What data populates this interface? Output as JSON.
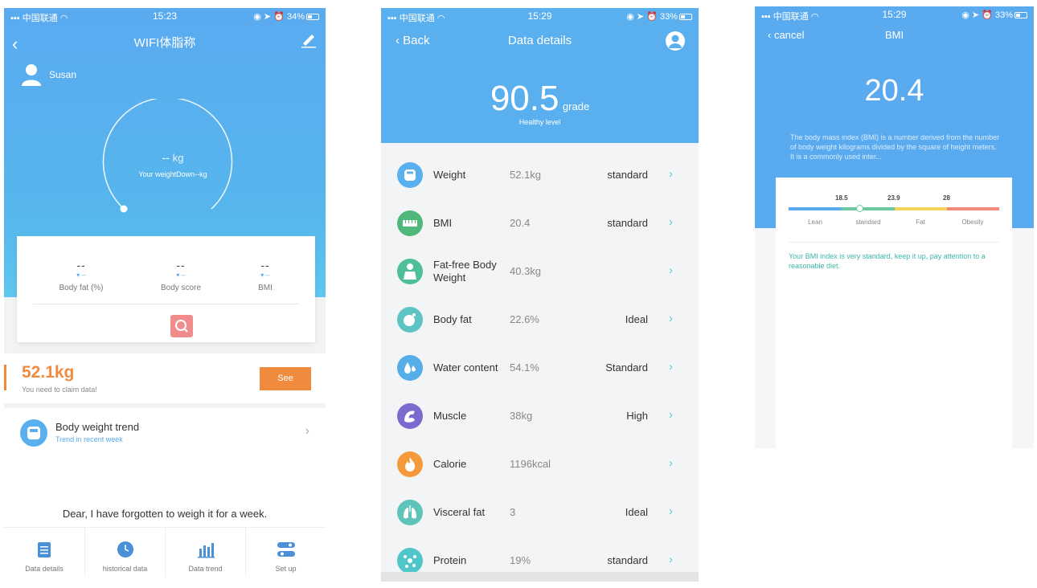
{
  "screen1": {
    "status": {
      "carrier": "中国联通",
      "time": "15:23",
      "battery": "34%"
    },
    "title": "WIFI体脂称",
    "user_name": "Susan",
    "gauge": {
      "value": "--",
      "unit": "kg",
      "subtitle": "Your weightDown--kg"
    },
    "metrics": [
      {
        "value": "--",
        "trend": "▾ --",
        "label": "Body fat (%)"
      },
      {
        "value": "--",
        "trend": "▾ --",
        "label": "Body score"
      },
      {
        "value": "--",
        "trend": "▾ --",
        "label": "BMI"
      }
    ],
    "weight": {
      "value": "52.1kg",
      "note": "You need to claim data!",
      "button": "See"
    },
    "trend": {
      "title": "Body weight trend",
      "subtitle": "Trend in recent week"
    },
    "reminder": "Dear, I have forgotten to weigh it for a week.",
    "tabs": [
      {
        "label": "Data details",
        "icon": "clipboard-icon"
      },
      {
        "label": "historical data",
        "icon": "clock-icon"
      },
      {
        "label": "Data trend",
        "icon": "bar-chart-icon"
      },
      {
        "label": "Set up",
        "icon": "settings-icon"
      }
    ]
  },
  "screen2": {
    "status": {
      "carrier": "中国联通",
      "time": "15:29",
      "battery": "33%"
    },
    "back_label": "Back",
    "title": "Data details",
    "score": {
      "value": "90.5",
      "unit": "grade",
      "level": "Healthy level"
    },
    "rows": [
      {
        "name": "Weight",
        "value": "52.1kg",
        "status": "standard",
        "icon": "scale-icon",
        "color": "#5ab0ee"
      },
      {
        "name": "BMI",
        "value": "20.4",
        "status": "standard",
        "icon": "ruler-icon",
        "color": "#4fb87a"
      },
      {
        "name": "Fat-free Body Weight",
        "value": "40.3kg",
        "status": "",
        "icon": "body-icon",
        "color": "#4fbf9a"
      },
      {
        "name": "Body fat",
        "value": "22.6%",
        "status": "Ideal",
        "icon": "fat-drop-icon",
        "color": "#5cc4c4"
      },
      {
        "name": "Water content",
        "value": "54.1%",
        "status": "Standard",
        "icon": "water-drop-icon",
        "color": "#56aee8"
      },
      {
        "name": "Muscle",
        "value": "38kg",
        "status": "High",
        "icon": "muscle-icon",
        "color": "#7a6ccf"
      },
      {
        "name": "Calorie",
        "value": "1196kcal",
        "status": "",
        "icon": "flame-icon",
        "color": "#f59a3c"
      },
      {
        "name": "Visceral fat",
        "value": "3",
        "status": "Ideal",
        "icon": "lungs-icon",
        "color": "#5cc4b8"
      },
      {
        "name": "Protein",
        "value": "19%",
        "status": "standard",
        "icon": "molecule-icon",
        "color": "#4fc6c9"
      }
    ]
  },
  "screen3": {
    "status": {
      "carrier": "中国联通",
      "time": "15:29",
      "battery": "33%"
    },
    "cancel_label": "cancel",
    "title": "BMI",
    "value": "20.4",
    "description": "The body mass index (BMI) is a number derived from the number of body weight kilograms divided by the square of height meters. It is a commonly used inter...",
    "thresholds": [
      "18.5",
      "23.9",
      "28"
    ],
    "segments": [
      {
        "label": "Lean",
        "color": "#5aaaf0"
      },
      {
        "label": "standard",
        "color": "#6cc6a0"
      },
      {
        "label": "Fat",
        "color": "#f5d25a"
      },
      {
        "label": "Obesity",
        "color": "#f08a7a"
      }
    ],
    "advice": "Your BMI index is very standard, keep it up, pay attention to a reasonable diet."
  }
}
